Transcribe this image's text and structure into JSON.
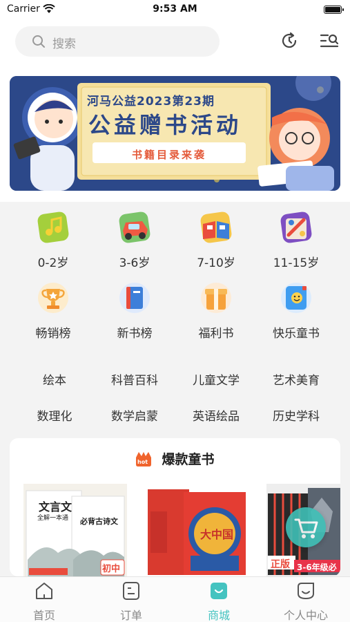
{
  "status_bar": {
    "carrier": "Carrier",
    "time": "9:53 AM"
  },
  "header": {
    "search_placeholder": "搜索"
  },
  "banner": {
    "line1": "河马公益2023第23期",
    "line2": "公益赠书活动",
    "line3": "书籍目录来袭"
  },
  "age_groups": [
    {
      "label": "0-2岁",
      "icon": "music-note-icon"
    },
    {
      "label": "3-6岁",
      "icon": "toy-car-icon"
    },
    {
      "label": "7-10岁",
      "icon": "open-book-icon"
    },
    {
      "label": "11-15岁",
      "icon": "art-palette-icon"
    }
  ],
  "lists": [
    {
      "label": "畅销榜",
      "icon": "trophy-icon"
    },
    {
      "label": "新书榜",
      "icon": "notebook-icon"
    },
    {
      "label": "福利书",
      "icon": "gift-icon"
    },
    {
      "label": "快乐童书",
      "icon": "smile-book-icon"
    }
  ],
  "tags": [
    "绘本",
    "科普百科",
    "儿童文学",
    "艺术美育",
    "数理化",
    "数学启蒙",
    "英语绘品",
    "历史学科"
  ],
  "hot_section": {
    "badge": "hot",
    "title": "爆款童书",
    "books": [
      {
        "cover_text_1": "文言文",
        "cover_text_2": "全解一本通",
        "cover_text_3": "必背古诗文",
        "cover_text_4": "初中"
      },
      {
        "cover_text_1": "大中国"
      },
      {
        "cover_text_1": "正版",
        "cover_text_2": "3-6年级必"
      }
    ]
  },
  "tab_bar": {
    "items": [
      {
        "label": "首页",
        "icon": "home-icon"
      },
      {
        "label": "订单",
        "icon": "order-icon"
      },
      {
        "label": "商城",
        "icon": "mall-icon",
        "active": true
      },
      {
        "label": "个人中心",
        "icon": "profile-icon"
      }
    ]
  },
  "colors": {
    "accent": "#44c3c0",
    "hot": "#f0642d"
  }
}
